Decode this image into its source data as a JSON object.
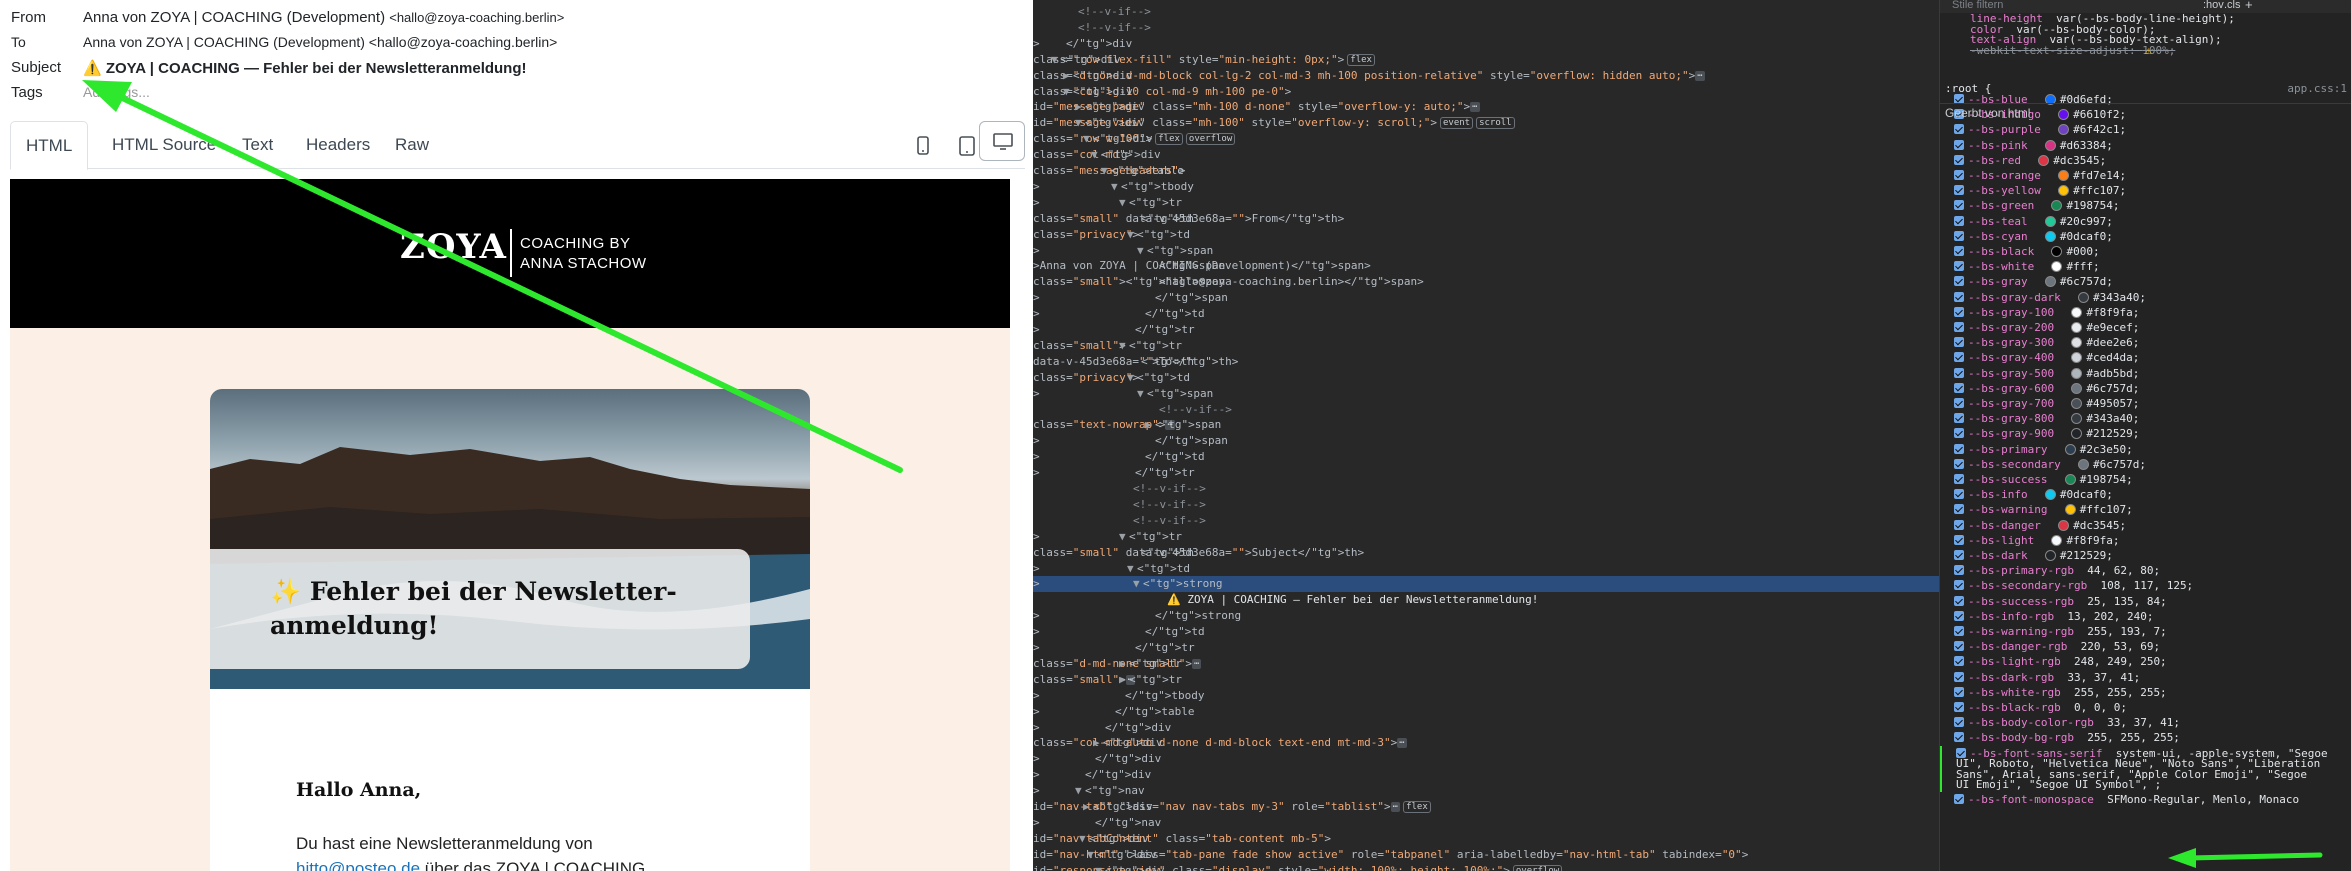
{
  "email": {
    "from_label": "From",
    "from_name": "Anna von ZOYA | COACHING (Development)",
    "from_email": "<hallo@zoya-coaching.berlin>",
    "to_label": "To",
    "to_value": "Anna von ZOYA | COACHING (Development) <hallo@zoya-coaching.berlin>",
    "subject_label": "Subject",
    "subject_value": "⚠️ ZOYA | COACHING — Fehler bei der Newsletteranmeldung!",
    "tags_label": "Tags",
    "tags_placeholder": "Add tags..."
  },
  "tabs": [
    "HTML",
    "HTML Source",
    "Text",
    "Headers",
    "Raw"
  ],
  "preview": {
    "logo": "ZOYA",
    "logo_sub1": "COACHING BY",
    "logo_sub2": "ANNA STACHOW",
    "headline_line1": "✨ Fehler bei der Newsletter-",
    "headline_line2": "anmeldung!",
    "greeting": "Hallo Anna,",
    "body_line1": "Du hast eine Newsletteranmeldung von",
    "body_link": "hitto@posteo.de",
    "body_line2_rest": " über das ZOYA | COACHING"
  },
  "devtools": {
    "filter_placeholder": "Stile filtern",
    "toolbar": [
      ":hov",
      ".cls",
      "+"
    ],
    "section_title": "Geerbt von html",
    "root_selector": ":root {",
    "source": "app.css:1",
    "top_rules": [
      {
        "name": "line-height",
        "value": "var(--bs-body-line-height);"
      },
      {
        "name": "color",
        "value": "var(--bs-body-color);"
      },
      {
        "name": "text-align",
        "value": "var(--bs-body-text-align);"
      },
      {
        "name": "-webkit-text-size-adjust",
        "value": "100%;"
      }
    ],
    "vars": [
      {
        "name": "--bs-blue",
        "value": "#0d6efd;",
        "color": "#0d6efd"
      },
      {
        "name": "--bs-indigo",
        "value": "#6610f2;",
        "color": "#6610f2"
      },
      {
        "name": "--bs-purple",
        "value": "#6f42c1;",
        "color": "#6f42c1"
      },
      {
        "name": "--bs-pink",
        "value": "#d63384;",
        "color": "#d63384"
      },
      {
        "name": "--bs-red",
        "value": "#dc3545;",
        "color": "#dc3545"
      },
      {
        "name": "--bs-orange",
        "value": "#fd7e14;",
        "color": "#fd7e14"
      },
      {
        "name": "--bs-yellow",
        "value": "#ffc107;",
        "color": "#ffc107"
      },
      {
        "name": "--bs-green",
        "value": "#198754;",
        "color": "#198754"
      },
      {
        "name": "--bs-teal",
        "value": "#20c997;",
        "color": "#20c997"
      },
      {
        "name": "--bs-cyan",
        "value": "#0dcaf0;",
        "color": "#0dcaf0"
      },
      {
        "name": "--bs-black",
        "value": "#000;",
        "color": "#000000"
      },
      {
        "name": "--bs-white",
        "value": "#fff;",
        "color": "#ffffff"
      },
      {
        "name": "--bs-gray",
        "value": "#6c757d;",
        "color": "#6c757d"
      },
      {
        "name": "--bs-gray-dark",
        "value": "#343a40;",
        "color": "#343a40"
      },
      {
        "name": "--bs-gray-100",
        "value": "#f8f9fa;",
        "color": "#f8f9fa"
      },
      {
        "name": "--bs-gray-200",
        "value": "#e9ecef;",
        "color": "#e9ecef"
      },
      {
        "name": "--bs-gray-300",
        "value": "#dee2e6;",
        "color": "#dee2e6"
      },
      {
        "name": "--bs-gray-400",
        "value": "#ced4da;",
        "color": "#ced4da"
      },
      {
        "name": "--bs-gray-500",
        "value": "#adb5bd;",
        "color": "#adb5bd"
      },
      {
        "name": "--bs-gray-600",
        "value": "#6c757d;",
        "color": "#6c757d"
      },
      {
        "name": "--bs-gray-700",
        "value": "#495057;",
        "color": "#495057"
      },
      {
        "name": "--bs-gray-800",
        "value": "#343a40;",
        "color": "#343a40"
      },
      {
        "name": "--bs-gray-900",
        "value": "#212529;",
        "color": "#212529"
      },
      {
        "name": "--bs-primary",
        "value": "#2c3e50;",
        "color": "#2c3e50"
      },
      {
        "name": "--bs-secondary",
        "value": "#6c757d;",
        "color": "#6c757d"
      },
      {
        "name": "--bs-success",
        "value": "#198754;",
        "color": "#198754"
      },
      {
        "name": "--bs-info",
        "value": "#0dcaf0;",
        "color": "#0dcaf0"
      },
      {
        "name": "--bs-warning",
        "value": "#ffc107;",
        "color": "#ffc107"
      },
      {
        "name": "--bs-danger",
        "value": "#dc3545;",
        "color": "#dc3545"
      },
      {
        "name": "--bs-light",
        "value": "#f8f9fa;",
        "color": "#f8f9fa"
      },
      {
        "name": "--bs-dark",
        "value": "#212529;",
        "color": "#212529"
      },
      {
        "name": "--bs-primary-rgb",
        "value": "44, 62, 80;"
      },
      {
        "name": "--bs-secondary-rgb",
        "value": "108, 117, 125;"
      },
      {
        "name": "--bs-success-rgb",
        "value": "25, 135, 84;"
      },
      {
        "name": "--bs-info-rgb",
        "value": "13, 202, 240;"
      },
      {
        "name": "--bs-warning-rgb",
        "value": "255, 193, 7;"
      },
      {
        "name": "--bs-danger-rgb",
        "value": "220, 53, 69;"
      },
      {
        "name": "--bs-light-rgb",
        "value": "248, 249, 250;"
      },
      {
        "name": "--bs-dark-rgb",
        "value": "33, 37, 41;"
      },
      {
        "name": "--bs-white-rgb",
        "value": "255, 255, 255;"
      },
      {
        "name": "--bs-black-rgb",
        "value": "0, 0, 0;"
      },
      {
        "name": "--bs-body-color-rgb",
        "value": "33, 37, 41;"
      },
      {
        "name": "--bs-body-bg-rgb",
        "value": "255, 255, 255;"
      }
    ],
    "font_sans_name": "--bs-font-sans-serif",
    "font_sans_lines": [
      "system-ui, -apple-system, \"Segoe",
      "UI\", Roboto, \"Helvetica Neue\", \"Noto Sans\", \"Liberation",
      "Sans\", Arial, sans-serif, \"Apple Color Emoji\", \"Segoe",
      "UI Emoji\", \"Segoe UI Symbol\", ;"
    ],
    "font_mono_name": "--bs-font-monospace",
    "font_mono_value": "SFMono-Regular, Menlo, Monaco"
  },
  "dom_lines": [
    "<!--v-if-->",
    "<!--v-if-->",
    "</div>",
    "<div class=\"row flex-fill\" style=\"min-height: 0px;\">",
    "<div class=\"d-none d-md-block col-lg-2 col-md-3 mh-100 position-relative\" style=\"overflow: hidden auto;\">",
    "<div class=\"col-lg-10 col-md-9 mh-100 pe-0\">",
    "<div id=\"message-page\" class=\"mh-100 d-none\" style=\"overflow-y: auto;\">",
    "<div id=\"message-view\" class=\"mh-100\" style=\"overflow-y: scroll;\">",
    "<div class=\"row w-100\">",
    "<div class=\"col-md\">",
    "<table class=\"messageHeaders\">",
    "<tbody>",
    "<tr>",
    "<th class=\"small\" data-v-45d3e68a=\"\">From</th>",
    "<td class=\"privacy\">",
    "<span>",
    "<span>Anna von ZOYA | COACHING (Development)</span>",
    "<span class=\"small\"><hallo@zoya-coaching.berlin></span>",
    "</span>",
    "</td>",
    "</tr>",
    "<tr class=\"small\">",
    "<th data-v-45d3e68a=\"\">To</th>",
    "<td class=\"privacy\">",
    "<span>",
    "<!--v-if-->",
    "<span class=\"text-nowrap\">",
    "</span>",
    "</td>",
    "</tr>",
    "<!--v-if-->",
    "<!--v-if-->",
    "<!--v-if-->",
    "<tr>",
    "<th class=\"small\" data-v-45d3e68a=\"\">Subject</th>",
    "<td>",
    "<strong>",
    "⚠️ ZOYA | COACHING — Fehler bei der Newsletteranmeldung!",
    "</strong>",
    "</td>",
    "</tr>",
    "<tr class=\"d-md-none small\">",
    "<tr class=\"small\">",
    "</tbody>",
    "</table>",
    "</div>",
    "<div class=\"col-md-auto d-none d-md-block text-end mt-md-3\">",
    "</div>",
    "</div>",
    "<nav>",
    "<div id=\"nav-tab\" class=\"nav nav-tabs my-3\" role=\"tablist\">",
    "</nav>",
    "<div id=\"nav-tabContent\" class=\"tab-content mb-5\">",
    "<div id=\"nav-html\" class=\"tab-pane fade show active\" role=\"tabpanel\" aria-labelledby=\"nav-html-tab\" tabindex=\"0\">",
    "<div id=\"responsive-view\" class=\"display\" style=\"width: 100%; height: 100%;\">"
  ],
  "dom_badges": {
    "flex": "flex",
    "overflow": "overflow",
    "event": "event",
    "scroll": "scroll",
    "ellipsis": "⋯"
  }
}
